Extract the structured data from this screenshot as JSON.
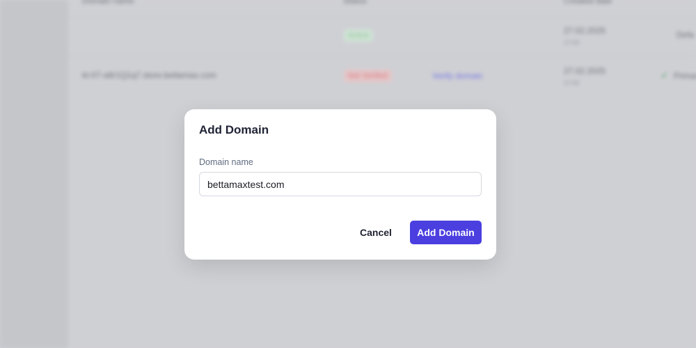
{
  "background": {
    "columns": [
      "Domain name",
      "Status",
      "Created date"
    ],
    "rows": [
      {
        "domain": "",
        "status": "Active",
        "action": "",
        "date": "27.02.2025",
        "time": "17:02",
        "extra": "Defa"
      },
      {
        "domain": "kt-07-a8r1Q1q7.store.bettamax.com",
        "status": "Not Verified",
        "action": "Verify domain",
        "date": "27.02.2025",
        "time": "17:02",
        "extra": "Primar"
      }
    ]
  },
  "modal": {
    "title": "Add Domain",
    "field_label": "Domain name",
    "field_value": "bettamaxtest.com",
    "cancel_label": "Cancel",
    "submit_label": "Add Domain"
  },
  "colors": {
    "accent": "#4b3fe0",
    "overlay": "#cfd0d4"
  }
}
